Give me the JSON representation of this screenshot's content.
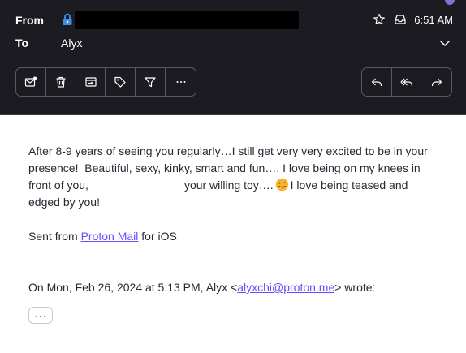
{
  "header": {
    "from_label": "From",
    "to_label": "To",
    "to_value": "Alyx",
    "time": "6:51 AM"
  },
  "toolbar": {
    "left_actions": [
      "mark-unread",
      "trash",
      "move-to",
      "label",
      "filter",
      "more"
    ],
    "right_actions": [
      "reply",
      "reply-all",
      "forward"
    ]
  },
  "message": {
    "paragraph1_a": "After 8-9 years of seeing you regularly…I still get very very excited to be in your presence!  Beautiful, sexy, kinky, smart and fun…. I love being on my knees in front of you,",
    "paragraph1_b": "your willing toy….",
    "paragraph1_c": "I love being teased and edged by you!",
    "sent_from_prefix": "Sent from ",
    "sent_from_link": "Proton Mail",
    "sent_from_suffix": " for iOS",
    "quote_prefix": "On Mon, Feb 26, 2024 at 5:13 PM, Alyx <",
    "quote_email": "alyxchi@proton.me",
    "quote_suffix": "> wrote:",
    "expand_quote": "···"
  },
  "colors": {
    "header_bg": "#1c1b22",
    "accent": "#6d4aff",
    "body_text": "#262a33"
  }
}
